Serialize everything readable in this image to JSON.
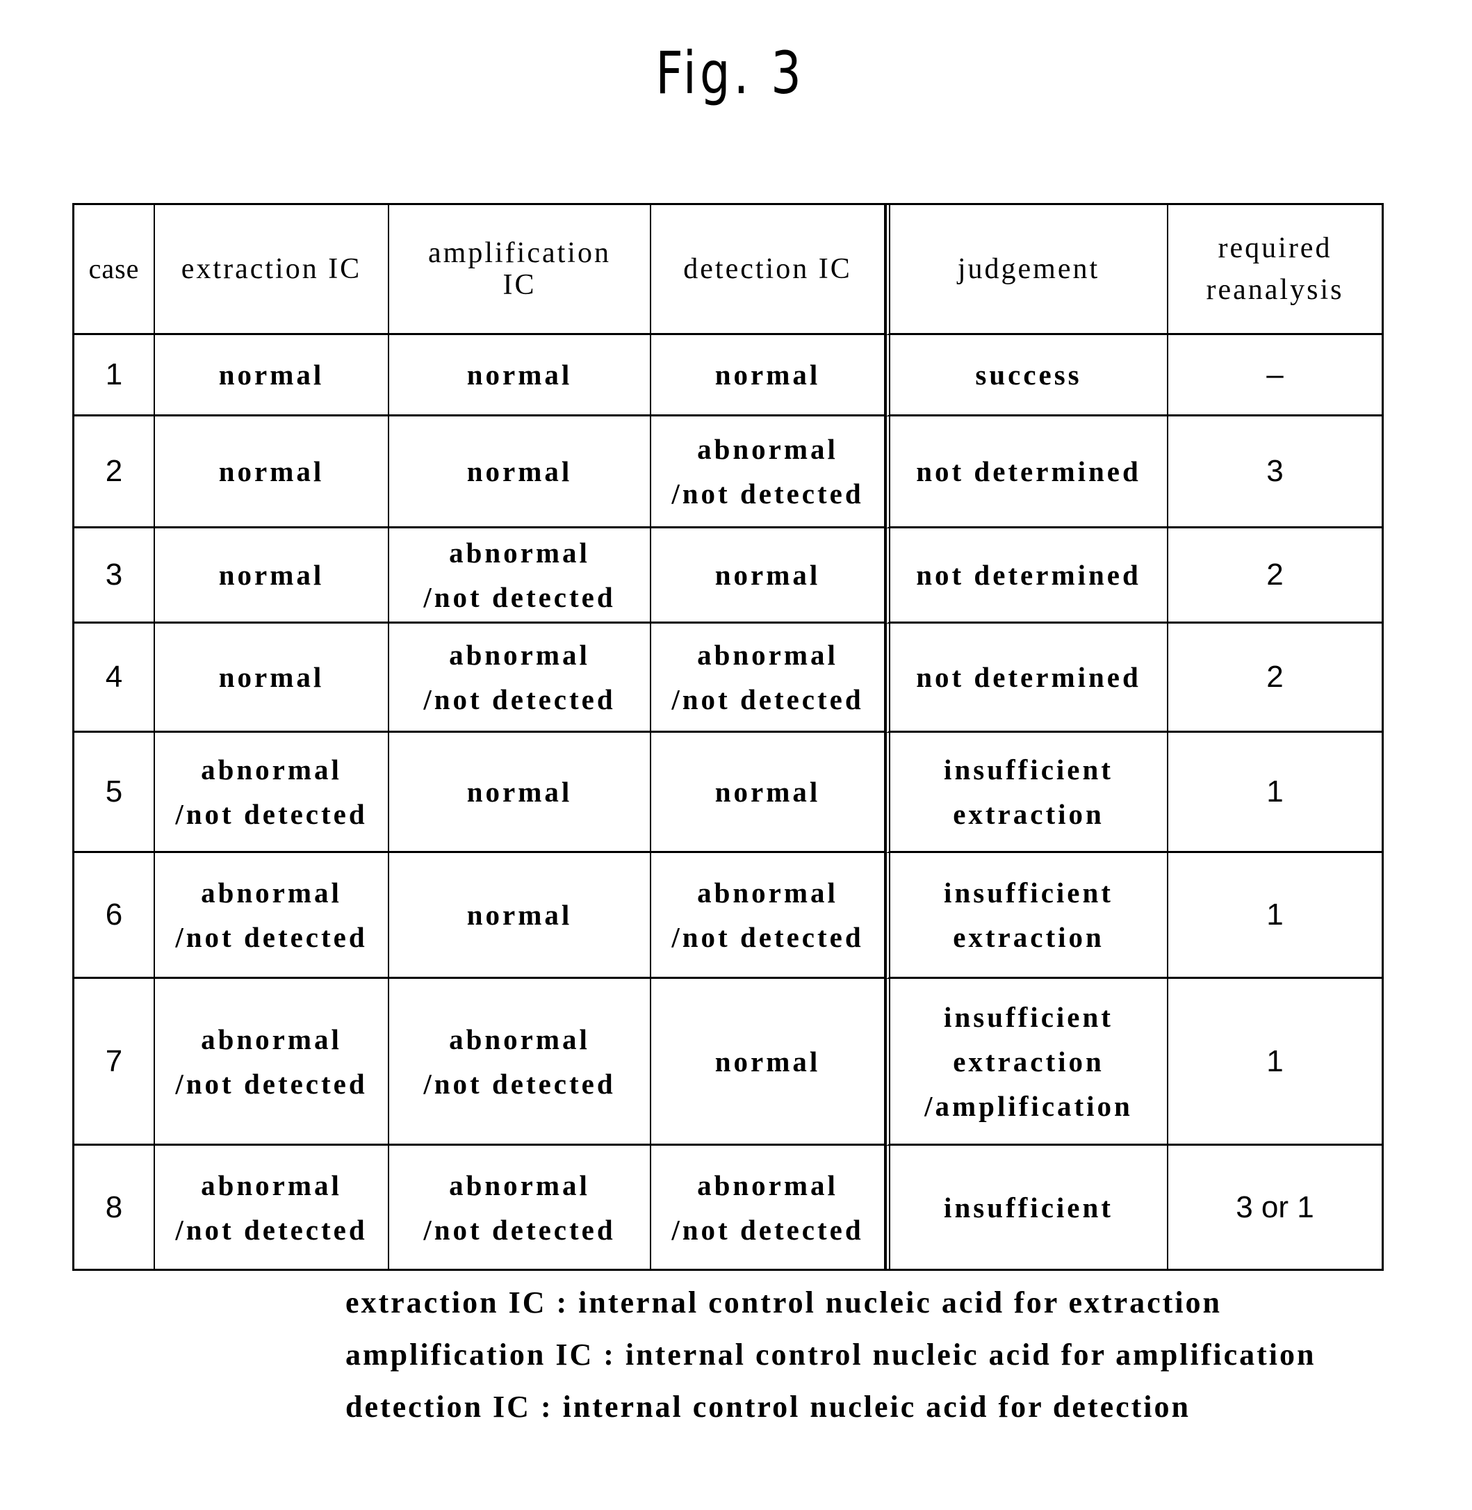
{
  "figure": {
    "title": "Fig. 3"
  },
  "table": {
    "headers": [
      "case",
      "extraction IC",
      "amplification\nIC",
      "detection IC",
      "judgement",
      "required\nreanalysis"
    ],
    "rows": [
      {
        "case": "1",
        "extraction_ic": "normal",
        "amplification_ic": "normal",
        "detection_ic": "normal",
        "judgement": "success",
        "required_reanalysis": "–"
      },
      {
        "case": "2",
        "extraction_ic": "normal",
        "amplification_ic": "normal",
        "detection_ic": "abnormal\n/not detected",
        "judgement": "not determined",
        "required_reanalysis": "3"
      },
      {
        "case": "3",
        "extraction_ic": "normal",
        "amplification_ic": "abnormal\n/not detected",
        "detection_ic": "normal",
        "judgement": "not determined",
        "required_reanalysis": "2"
      },
      {
        "case": "4",
        "extraction_ic": "normal",
        "amplification_ic": "abnormal\n/not detected",
        "detection_ic": "abnormal\n/not detected",
        "judgement": "not determined",
        "required_reanalysis": "2"
      },
      {
        "case": "5",
        "extraction_ic": "abnormal\n/not detected",
        "amplification_ic": "normal",
        "detection_ic": "normal",
        "judgement": "insufficient\nextraction",
        "required_reanalysis": "1"
      },
      {
        "case": "6",
        "extraction_ic": "abnormal\n/not detected",
        "amplification_ic": "normal",
        "detection_ic": "abnormal\n/not detected",
        "judgement": "insufficient\nextraction",
        "required_reanalysis": "1"
      },
      {
        "case": "7",
        "extraction_ic": "abnormal\n/not detected",
        "amplification_ic": "abnormal\n/not detected",
        "detection_ic": "normal",
        "judgement": "insufficient\nextraction\n/amplification",
        "required_reanalysis": "1"
      },
      {
        "case": "8",
        "extraction_ic": "abnormal\n/not detected",
        "amplification_ic": "abnormal\n/not detected",
        "detection_ic": "abnormal\n/not detected",
        "judgement": "insufficient",
        "required_reanalysis": "3 or 1"
      }
    ]
  },
  "legend": [
    "extraction IC : internal control nucleic acid for extraction",
    "amplification IC : internal control nucleic acid for amplification",
    "detection IC : internal control nucleic acid for detection"
  ]
}
